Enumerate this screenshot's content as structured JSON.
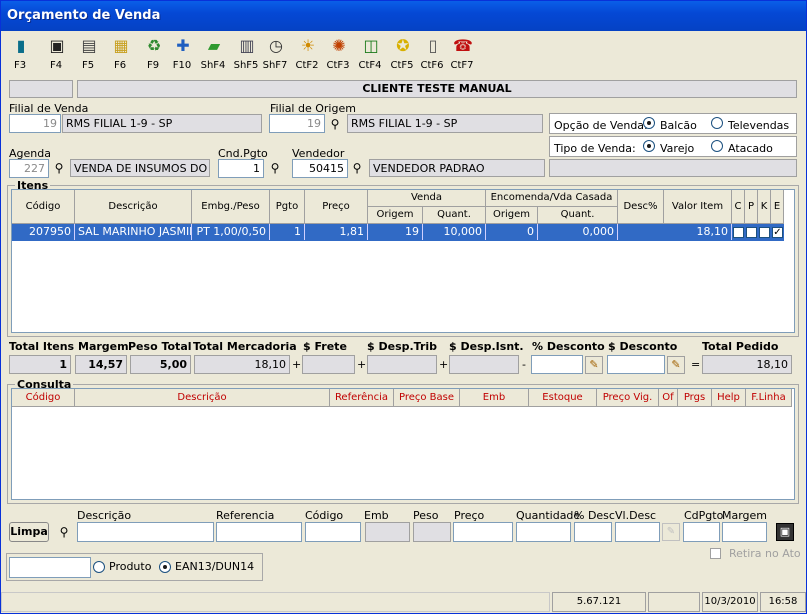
{
  "window": {
    "title": "Orçamento de Venda"
  },
  "toolbar": [
    {
      "key": "F3",
      "icon": "exit-door-icon"
    },
    {
      "key": "F4",
      "icon": "save-disk-icon"
    },
    {
      "key": "F5",
      "icon": "document-list-icon"
    },
    {
      "key": "F6",
      "icon": "stacked-boxes-icon"
    },
    {
      "key": "F9",
      "icon": "recycle-bin-icon"
    },
    {
      "key": "F10",
      "icon": "puzzle-icon"
    },
    {
      "key": "ShF4",
      "icon": "money-note-icon"
    },
    {
      "key": "ShF5",
      "icon": "cash-register-icon"
    },
    {
      "key": "ShF7",
      "icon": "clock-icon"
    },
    {
      "key": "CtF2",
      "icon": "sun-card-icon"
    },
    {
      "key": "CtF3",
      "icon": "palette-icon"
    },
    {
      "key": "CtF4",
      "icon": "chart-icon"
    },
    {
      "key": "CtF5",
      "icon": "light-bulb-icon"
    },
    {
      "key": "CtF6",
      "icon": "trash-can-icon"
    },
    {
      "key": "CtF7",
      "icon": "telephone-icon"
    }
  ],
  "header": {
    "client_name": "CLIENTE TESTE MANUAL",
    "client_code": ""
  },
  "filial_venda": {
    "label": "Filial de Venda",
    "code": "19",
    "name": "RMS FILIAL 1-9 - SP"
  },
  "filial_origem": {
    "label": "Filial de Origem",
    "code": "19",
    "name": "RMS FILIAL 1-9 - SP"
  },
  "opcao_venda": {
    "label": "Opção de Venda:",
    "options": [
      "Balcão",
      "Televendas"
    ],
    "selected": "Balcão"
  },
  "tipo_venda": {
    "label": "Tipo de Venda:",
    "options": [
      "Varejo",
      "Atacado"
    ],
    "selected": "Varejo"
  },
  "agenda": {
    "label": "Agenda",
    "code": "227",
    "name": "VENDA DE INSUMOS DO PDV"
  },
  "cnd_pgto": {
    "label": "Cnd.Pgto",
    "value": "1"
  },
  "vendedor": {
    "label": "Vendedor",
    "code": "50415",
    "name": "VENDEDOR PADRAO"
  },
  "itens": {
    "label": "Itens",
    "columns": {
      "codigo": "Código",
      "descricao": "Descrição",
      "embg_peso": "Embg./Peso",
      "pgto": "Pgto",
      "preco": "Preço",
      "venda": "Venda",
      "origem": "Origem",
      "quant": "Quant.",
      "encomenda": "Encomenda/Vda Casada",
      "enc_origem": "Origem",
      "enc_quant": "Quant.",
      "desc_pct": "Desc%",
      "valor_item": "Valor Item",
      "c": "C",
      "p": "P",
      "k": "K",
      "e": "E"
    },
    "rows": [
      {
        "codigo": "207950",
        "descricao": "SAL MARINHO JASMINE",
        "embg_peso": "PT 1,00/0,50",
        "pgto": "1",
        "preco": "1,81",
        "origem": "19",
        "quant": "10,000",
        "enc_origem": "0",
        "enc_quant": "0,000",
        "desc_pct": "",
        "valor_item": "18,10",
        "c": false,
        "p": false,
        "k": false,
        "e": true
      }
    ]
  },
  "totals": {
    "total_itens": {
      "label": "Total Itens",
      "value": "1"
    },
    "margem": {
      "label": "Margem",
      "value": "14,57"
    },
    "peso_total": {
      "label": "Peso Total",
      "value": "5,00"
    },
    "total_mercadoria": {
      "label": "Total Mercadoria",
      "value": "18,10"
    },
    "frete": {
      "label": "$ Frete",
      "value": ""
    },
    "desp_trib": {
      "label": "$ Desp.Trib",
      "value": ""
    },
    "desp_isnt": {
      "label": "$ Desp.Isnt.",
      "value": ""
    },
    "pct_desconto": {
      "label": "% Desconto",
      "value": ""
    },
    "desconto": {
      "label": "$ Desconto",
      "value": ""
    },
    "total_pedido": {
      "label": "Total Pedido",
      "value": "18,10"
    },
    "ops": {
      "plus": "+",
      "minus": "-",
      "equals": "="
    }
  },
  "consulta": {
    "label": "Consulta",
    "columns": [
      "Código",
      "Descrição",
      "Referência",
      "Preço Base",
      "Emb",
      "Estoque",
      "Preço Vig.",
      "Of",
      "Prgs",
      "Help",
      "F.Linha"
    ]
  },
  "search": {
    "limpa": "Limpa",
    "labels": {
      "descricao": "Descrição",
      "referencia": "Referencia",
      "codigo": "Código",
      "emb": "Emb",
      "peso": "Peso",
      "preco": "Preço",
      "quantidade": "Quantidade",
      "pct_desc": "% Desc",
      "vl_desc": "Vl.Desc",
      "cdpgto": "CdPgto",
      "margem": "Margem"
    },
    "retira_no_ato": "Retira no Ato",
    "scan_options": [
      "Produto",
      "EAN13/DUN14"
    ],
    "scan_selected": "EAN13/DUN14"
  },
  "status_bar": {
    "version": "5.67.121",
    "date": "10/3/2010",
    "time": "16:58"
  }
}
